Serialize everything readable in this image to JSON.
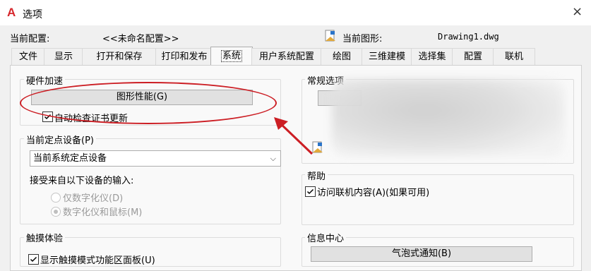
{
  "window": {
    "app_icon": "A",
    "title": "选项",
    "close": "×"
  },
  "config": {
    "current_profile_label": "当前配置:",
    "current_profile_value": "<<未命名配置>>",
    "current_drawing_label": "当前图形:",
    "current_drawing_value": "Drawing1.dwg",
    "drawing_icon": "drawing-file-icon"
  },
  "tabs": [
    {
      "label": "文件"
    },
    {
      "label": "显示"
    },
    {
      "label": "打开和保存"
    },
    {
      "label": "打印和发布"
    },
    {
      "label": "系统",
      "active": true
    },
    {
      "label": "用户系统配置"
    },
    {
      "label": "绘图"
    },
    {
      "label": "三维建模"
    },
    {
      "label": "选择集"
    },
    {
      "label": "配置"
    },
    {
      "label": "联机"
    }
  ],
  "hardware": {
    "title": "硬件加速",
    "graphics_button": "图形性能(G)",
    "auto_check_label": "自动检查证书更新",
    "auto_check_checked": true
  },
  "pointing": {
    "title": "当前定点设备(P)",
    "selected": "当前系统定点设备",
    "accept_label": "接受来自以下设备的输入:",
    "radio_digitizer_only": "仅数字化仪(D)",
    "radio_digitizer_mouse": "数字化仪和鼠标(M)",
    "radio_selected": "digitizer_mouse"
  },
  "touch": {
    "title": "触摸体验",
    "show_touch_label": "显示触摸模式功能区面板(U)",
    "show_touch_checked": true
  },
  "general": {
    "title": "常规选项"
  },
  "help": {
    "title": "帮助",
    "access_online_label": "访问联机内容(A)(如果可用)",
    "access_online_checked": true
  },
  "info_center": {
    "title": "信息中心",
    "balloon_button": "气泡式通知(B)"
  },
  "colors": {
    "annotation_red": "#cc1e24",
    "app_icon_red": "#d6262b"
  }
}
